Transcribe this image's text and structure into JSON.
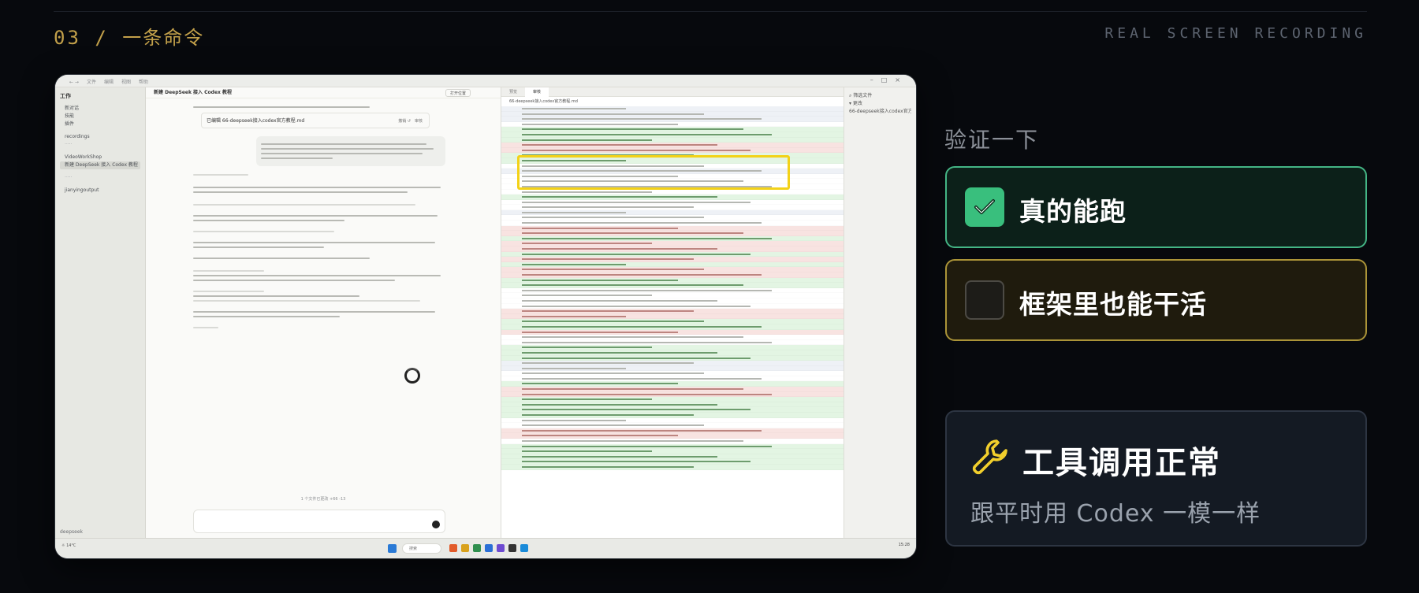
{
  "header": {
    "section_number": "03 / ",
    "section_title": "一条命令",
    "recording_tag": "REAL SCREEN RECORDING"
  },
  "screenshot": {
    "chat_title": "新建 DeepSeek 接入 Codex 教程",
    "open_location": "打开位置",
    "sidebar_title": "工作",
    "sidebar_items": [
      "新对话",
      "技能",
      "插件",
      "recordings",
      "VideoWorkShop",
      "新建 DeepSeek 接入 Codex 教程",
      "jianyingoutput"
    ],
    "file_card": "已编辑 66-deepseek接入codex官方教程.md",
    "diff_file": "66-deepseek接入codex官方教程.md",
    "changes_note": "1 个文件已更改 +66 -13",
    "taskbar_search": "搜索",
    "clock_time": "15:28"
  },
  "panel": {
    "verify_label": "验证一下",
    "items": [
      {
        "label": "真的能跑",
        "checked": true
      },
      {
        "label": "框架里也能干活",
        "checked": false
      }
    ],
    "tools_title": "工具调用正常",
    "tools_sub": "跟平时用 Codex 一模一样",
    "colors": {
      "accent_green": "#39bf7d",
      "accent_yellow": "#f3d218",
      "tag_gold": "#c2a04a"
    }
  }
}
